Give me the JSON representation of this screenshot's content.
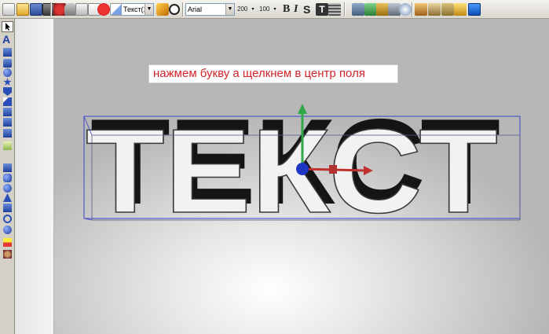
{
  "toolbar": {
    "object_select": "Текст(1)",
    "font_select": "Arial",
    "size_value": "200",
    "scale_value": "100",
    "bold_label": "B",
    "italic_label": "I",
    "strike_label": "S",
    "text_tool_label": "T"
  },
  "palette": {
    "text_tool_label": "A"
  },
  "viewport": {
    "hint_text": "нажмем букву а щелкнем в центр поля",
    "text_3d": "ТЕКСТ"
  },
  "colors": {
    "hint_text": "#d2232a",
    "selection_box": "#3b45c8",
    "gizmo_y": "#2fa84a",
    "gizmo_x": "#c0312e",
    "gizmo_center": "#1f35c4"
  },
  "icons": {
    "palette": [
      "pointer-icon",
      "text-tool-icon",
      "cube-icon",
      "box-icon",
      "sphere-icon",
      "star-icon",
      "shield-icon",
      "pen-icon",
      "clock-icon",
      "s-shape-icon",
      "image-icon",
      "bevel-icon",
      "cylinder-icon",
      "cone-icon",
      "ring-icon",
      "gear-icon",
      "lamp-icon",
      "eye-icon"
    ],
    "side_buttons": [
      "rotate-icon",
      "text-icon",
      "texture-icon",
      "back-icon",
      "down-icon",
      "pin-icon"
    ]
  }
}
